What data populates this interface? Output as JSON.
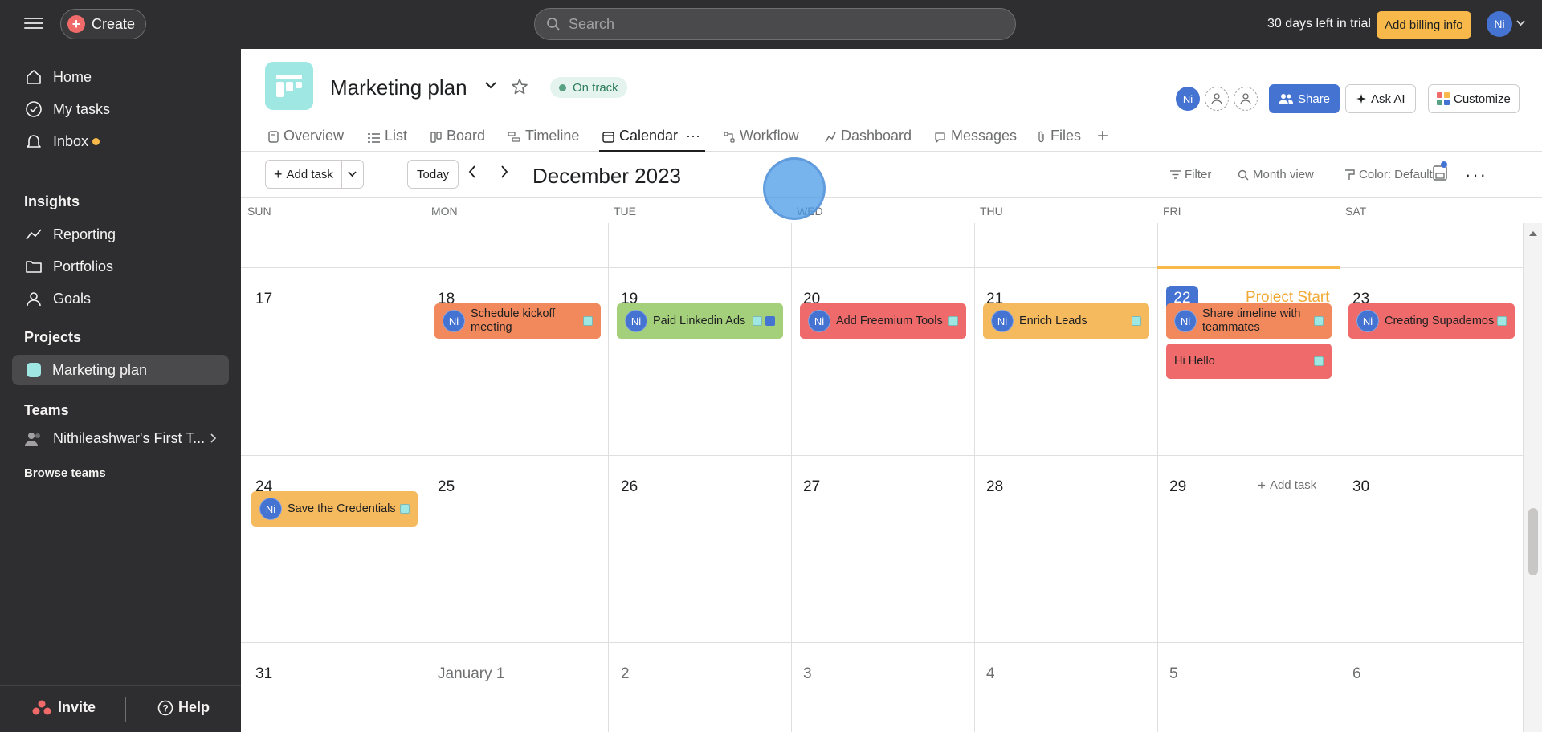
{
  "topbar": {
    "create_label": "Create",
    "search_placeholder": "Search",
    "trial_text": "30 days left in trial",
    "billing_label": "Add billing info",
    "user_initials": "Ni"
  },
  "sidebar": {
    "nav": [
      {
        "label": "Home",
        "icon": "home-icon"
      },
      {
        "label": "My tasks",
        "icon": "check-circle-icon"
      },
      {
        "label": "Inbox",
        "icon": "bell-icon"
      }
    ],
    "insights_heading": "Insights",
    "insights": [
      {
        "label": "Reporting",
        "icon": "trend-line-icon"
      },
      {
        "label": "Portfolios",
        "icon": "folder-icon"
      },
      {
        "label": "Goals",
        "icon": "person-icon"
      }
    ],
    "projects_heading": "Projects",
    "project_item": "Marketing plan",
    "teams_heading": "Teams",
    "team_item": "Nithileashwar's First T...",
    "browse_teams": "Browse teams",
    "invite_label": "Invite",
    "help_label": "Help"
  },
  "project": {
    "title": "Marketing plan",
    "status": "On track",
    "avatar_initials": "Ni",
    "share_label": "Share",
    "ask_ai_label": "Ask AI",
    "customize_label": "Customize"
  },
  "tabs": [
    {
      "label": "Overview",
      "icon": "doc-icon"
    },
    {
      "label": "List",
      "icon": "list-icon"
    },
    {
      "label": "Board",
      "icon": "board-icon"
    },
    {
      "label": "Timeline",
      "icon": "timeline-icon"
    },
    {
      "label": "Calendar",
      "icon": "calendar-icon",
      "more": "···"
    },
    {
      "label": "Workflow",
      "icon": "workflow-icon"
    },
    {
      "label": "Dashboard",
      "icon": "dashboard-icon"
    },
    {
      "label": "Messages",
      "icon": "message-icon"
    },
    {
      "label": "Files",
      "icon": "paperclip-icon"
    }
  ],
  "active_tab": "Calendar",
  "toolbar": {
    "add_task_label": "Add task",
    "today_label": "Today",
    "month_label": "December 2023",
    "filter_label": "Filter",
    "view_label": "Month view",
    "color_label": "Color: Default"
  },
  "calendar": {
    "weekdays": [
      "SUN",
      "MON",
      "TUE",
      "WED",
      "THU",
      "FRI",
      "SAT"
    ],
    "weeks": [
      [
        "17",
        "18",
        "19",
        "20",
        "21",
        "22",
        "23"
      ],
      [
        "24",
        "25",
        "26",
        "27",
        "28",
        "29",
        "30"
      ],
      [
        "31",
        "January 1",
        "2",
        "3",
        "4",
        "5",
        "6"
      ]
    ],
    "today": "22",
    "project_start_label": "Project Start",
    "add_task_label": "Add task",
    "tasks": [
      {
        "title": "Schedule kickoff meeting",
        "initials": "Ni",
        "color": "#f1895c"
      },
      {
        "title": "Paid Linkedin Ads",
        "initials": "Ni",
        "color": "#a4cf7b"
      },
      {
        "title": "Add Freemium Tools",
        "initials": "Ni",
        "color": "#ef6a6a"
      },
      {
        "title": "Enrich Leads",
        "initials": "Ni",
        "color": "#f5b95e"
      },
      {
        "title": "Share timeline with teammates",
        "initials": "Ni",
        "color": "#f1895c"
      },
      {
        "title": "Hi Hello",
        "color": "#ef6a6a"
      },
      {
        "title": "Creating Supademos",
        "initials": "Ni",
        "color": "#ef6a6a"
      },
      {
        "title": "Save the Credentials",
        "initials": "Ni",
        "color": "#f5b95e"
      }
    ]
  }
}
